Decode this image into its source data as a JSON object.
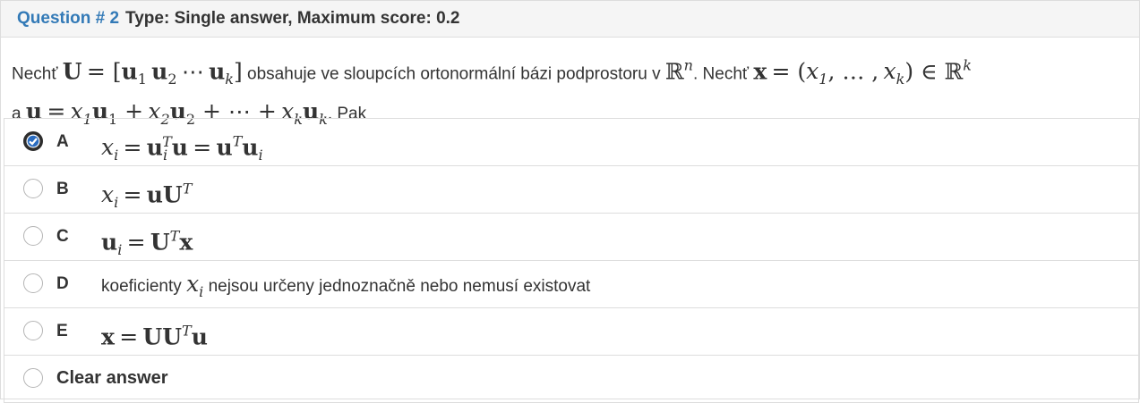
{
  "question": {
    "number_label": "Question # 2",
    "type_label": "Type: Single answer, Maximum score: 0.2"
  },
  "stem": {
    "t1": "Nechť",
    "t2": "obsahuje ve sloupcích ortonormální bázi podprostoru v",
    "t3": ". Nechť",
    "t4": "a",
    "t5": ". Pak"
  },
  "options": [
    {
      "letter": "A",
      "selected": true
    },
    {
      "letter": "B",
      "selected": false
    },
    {
      "letter": "C",
      "selected": false
    },
    {
      "letter": "D",
      "selected": false,
      "text_before": "koeficienty",
      "text_after": "nejsou určeny jednoznačně nebo nemusí existovat"
    },
    {
      "letter": "E",
      "selected": false
    }
  ],
  "clear_label": "Clear answer",
  "colors": {
    "accent": "#337ab7",
    "header_bg": "#f5f5f5",
    "border": "#dddddd"
  },
  "icons": {
    "selected": "checkmark-radio-icon"
  }
}
